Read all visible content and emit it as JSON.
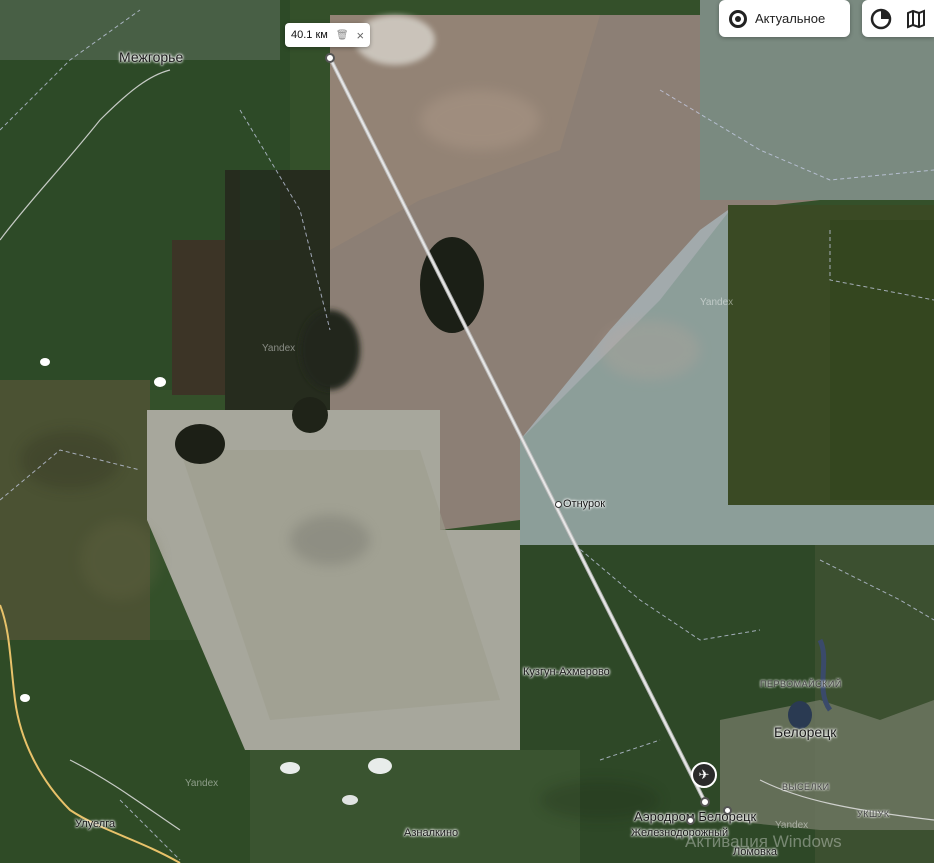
{
  "measure": {
    "distance": "40.1 км",
    "delete_icon": "trash-icon",
    "close_icon": "close-icon"
  },
  "controls": {
    "actual_label": "Актуальное",
    "actual_icon": "target-icon",
    "layers_icon": "layers-icon",
    "map_icon": "map-book-icon"
  },
  "places": {
    "mezhgorye": "Межгорье",
    "otnurok": "Отнурок",
    "kuzgun": "Кузгун-Ахмерово",
    "beloretsk": "Белорецк",
    "pervomaisky": "ПЕРВОМАЙСКИЙ",
    "vyselki": "ВЫСЕЛКИ",
    "ukshuk": "УКШУК",
    "uluelga": "Улуелга",
    "aznalkino": "Азналкино",
    "zheleznodorozhny": "Железнодорожный",
    "lomovka": "Ломовка",
    "aerodrome": "Аэродром Белорецк"
  },
  "yandex_marks": [
    "Yandex",
    "Yandex",
    "Yandex",
    "Yandex"
  ],
  "watermark": "Активация Windows",
  "colors": {
    "route_line": "#d8d8d8",
    "road": "#e8c26a",
    "forest": "#2f4a26",
    "steppe": "#8a8478"
  }
}
